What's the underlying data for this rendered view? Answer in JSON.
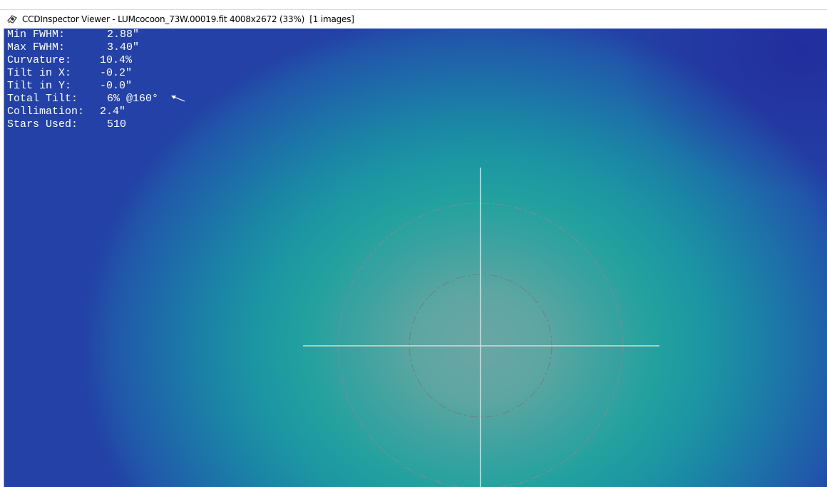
{
  "window": {
    "title": "CCDInspector Viewer - LUMcocoon_73W.00019.fit 4008x2672 (33%)  [1 images]",
    "icon": "ccdinspector-app-icon"
  },
  "stats": [
    {
      "label": "Min FWHM:",
      "value": "2.88\""
    },
    {
      "label": "Max FWHM:",
      "value": "3.40\""
    },
    {
      "label": "Curvature:",
      "value": "10.4%"
    },
    {
      "label": "Tilt in X:",
      "value": "-0.2\""
    },
    {
      "label": "Tilt in Y:",
      "value": "-0.0\""
    },
    {
      "label": "Total Tilt:",
      "value": "6% @160°"
    },
    {
      "label": "Collimation:",
      "value": "2.4\""
    },
    {
      "label": "Stars Used:",
      "value": "510"
    }
  ],
  "overlay": {
    "crosshair": "crosshair-icon",
    "circles": [
      "inner-fwhm-circle",
      "outer-fwhm-circle"
    ],
    "tilt_direction_icon": "tilt-arrow-icon",
    "colors": {
      "center": "#6aa6a4",
      "mid": "#22a19f",
      "edge": "#2341a6",
      "crosshair": "#d8d8d8",
      "circle": "#7a7a7a"
    }
  }
}
